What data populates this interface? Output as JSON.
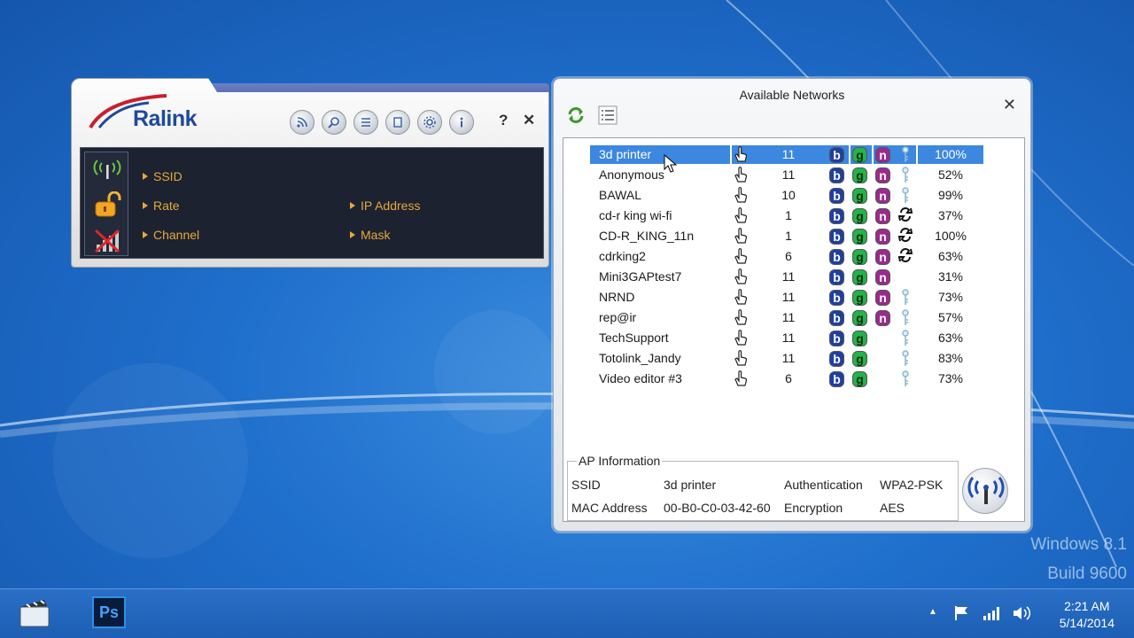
{
  "desktop": {
    "watermark_line1": "Windows 8.1",
    "watermark_line2": "Build 9600"
  },
  "ralink": {
    "logo_text": "Ralink",
    "toolbar_icons": [
      "rss-icon",
      "search-icon",
      "list-icon",
      "page-icon",
      "settings-icon",
      "info-icon"
    ],
    "help_label": "?",
    "close_label": "✕",
    "labels": {
      "ssid": "SSID",
      "rate": "Rate",
      "channel": "Channel",
      "ip_address": "IP Address",
      "mask": "Mask"
    },
    "colors": {
      "label": "#e7a83a",
      "panel": "#1c2230",
      "brand": "#1d4a9a"
    }
  },
  "networks": {
    "title": "Available Networks",
    "close_label": "✕",
    "rows": [
      {
        "ssid": "3d printer",
        "channel": "11",
        "b": true,
        "g": true,
        "n": true,
        "security": "key",
        "signal": "100%",
        "selected": true
      },
      {
        "ssid": "Anonymous",
        "channel": "11",
        "b": true,
        "g": true,
        "n": true,
        "security": "key",
        "signal": "52%"
      },
      {
        "ssid": "BAWAL",
        "channel": "10",
        "b": true,
        "g": true,
        "n": true,
        "security": "key",
        "signal": "99%"
      },
      {
        "ssid": "cd-r king wi-fi",
        "channel": "1",
        "b": true,
        "g": true,
        "n": true,
        "security": "wps",
        "signal": "37%"
      },
      {
        "ssid": "CD-R_KING_11n",
        "channel": "1",
        "b": true,
        "g": true,
        "n": true,
        "security": "wps",
        "signal": "100%"
      },
      {
        "ssid": "cdrking2",
        "channel": "6",
        "b": true,
        "g": true,
        "n": true,
        "security": "wps",
        "signal": "63%"
      },
      {
        "ssid": "Mini3GAPtest7",
        "channel": "11",
        "b": true,
        "g": true,
        "n": true,
        "security": "none",
        "signal": "31%"
      },
      {
        "ssid": "NRND",
        "channel": "11",
        "b": true,
        "g": true,
        "n": true,
        "security": "key",
        "signal": "73%"
      },
      {
        "ssid": "rep@ir",
        "channel": "11",
        "b": true,
        "g": true,
        "n": true,
        "security": "key",
        "signal": "57%"
      },
      {
        "ssid": "TechSupport",
        "channel": "11",
        "b": true,
        "g": true,
        "n": false,
        "security": "key",
        "signal": "63%"
      },
      {
        "ssid": "Totolink_Jandy",
        "channel": "11",
        "b": true,
        "g": true,
        "n": false,
        "security": "key",
        "signal": "83%"
      },
      {
        "ssid": "Video editor #3",
        "channel": "6",
        "b": true,
        "g": true,
        "n": false,
        "security": "key",
        "signal": "73%"
      }
    ],
    "badges": {
      "b": "b",
      "g": "g",
      "n": "n"
    },
    "ap_info": {
      "legend": "AP Information",
      "ssid_label": "SSID",
      "ssid_value": "3d printer",
      "auth_label": "Authentication",
      "auth_value": "WPA2-PSK",
      "mac_label": "MAC Address",
      "mac_value": "00-B0-C0-03-42-60",
      "enc_label": "Encryption",
      "enc_value": "AES"
    }
  },
  "taskbar": {
    "apps": [
      "media-center-icon",
      "photoshop-icon"
    ],
    "photoshop_label": "Ps",
    "time": "2:21 AM",
    "date": "5/14/2014"
  }
}
